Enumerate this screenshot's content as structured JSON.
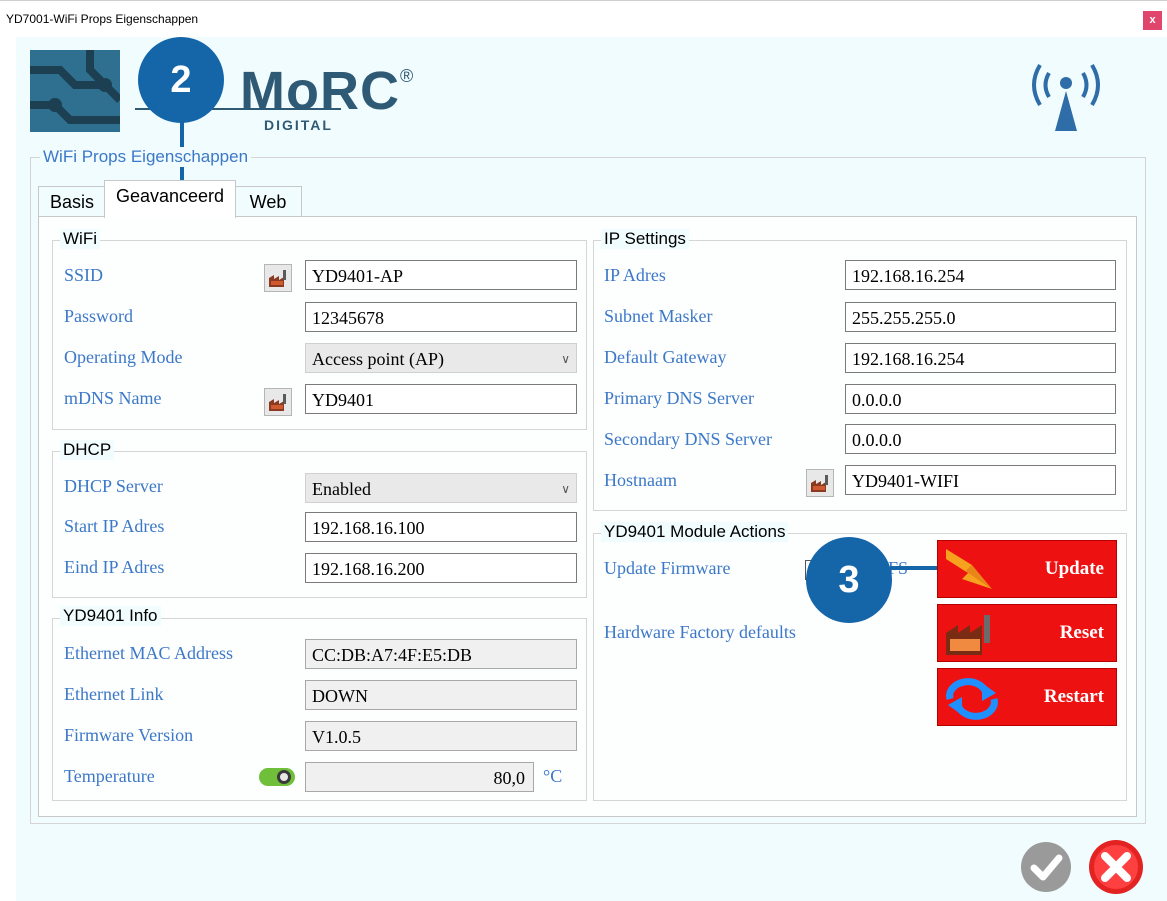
{
  "window": {
    "title": "YD7001-WiFi Props Eigenschappen",
    "close_label": "x"
  },
  "brand": {
    "name": "MoRC",
    "registered": "®",
    "sub": "DIGITAL"
  },
  "callouts": {
    "tab_callout": "2",
    "actions_callout": "3"
  },
  "group_title": "WiFi Props Eigenschappen",
  "tabs": [
    {
      "label": "Basis",
      "active": false
    },
    {
      "label": "Geavanceerd",
      "active": true
    },
    {
      "label": "Web",
      "active": false
    }
  ],
  "wifi": {
    "title": "WiFi",
    "ssid_label": "SSID",
    "ssid_value": "YD9401-AP",
    "password_label": "Password",
    "password_value": "12345678",
    "mode_label": "Operating Mode",
    "mode_value": "Access point (AP)",
    "mdns_label": "mDNS Name",
    "mdns_value": "YD9401"
  },
  "dhcp": {
    "title": "DHCP",
    "server_label": "DHCP Server",
    "server_value": "Enabled",
    "start_label": "Start IP Adres",
    "start_value": "192.168.16.100",
    "end_label": "Eind IP Adres",
    "end_value": "192.168.16.200"
  },
  "info": {
    "title": "YD9401 Info",
    "mac_label": "Ethernet MAC Address",
    "mac_value": "CC:DB:A7:4F:E5:DB",
    "link_label": "Ethernet Link",
    "link_value": "DOWN",
    "fw_label": "Firmware Version",
    "fw_value": "V1.0.5",
    "temp_label": "Temperature",
    "temp_value": "80,0",
    "temp_unit": "°C",
    "temp_toggle_on": true
  },
  "ip": {
    "title": "IP Settings",
    "ip_label": "IP Adres",
    "ip_value": "192.168.16.254",
    "subnet_label": "Subnet Masker",
    "subnet_value": "255.255.255.0",
    "gateway_label": "Default Gateway",
    "gateway_value": "192.168.16.254",
    "dns1_label": "Primary DNS Server",
    "dns1_value": "0.0.0.0",
    "dns2_label": "Secondary DNS Server",
    "dns2_value": "0.0.0.0",
    "host_label": "Hostnaam",
    "host_value": "YD9401-WIFI"
  },
  "actions": {
    "title": "YD9401 Module Actions",
    "update_fw_label": "Update Firmware",
    "update_fw_suffix": "FS",
    "factory_label": "Hardware Factory defaults",
    "update_button": "Update",
    "reset_button": "Reset",
    "restart_button": "Restart"
  },
  "icons": {
    "ok": "check-circle-icon",
    "cancel": "cancel-circle-icon",
    "factory": "factory-icon",
    "antenna": "wifi-antenna-icon"
  },
  "colors": {
    "accent_blue": "#1565a9",
    "label_blue": "#3c78c8",
    "action_red": "#ee1111",
    "background": "#f1fcfe"
  }
}
